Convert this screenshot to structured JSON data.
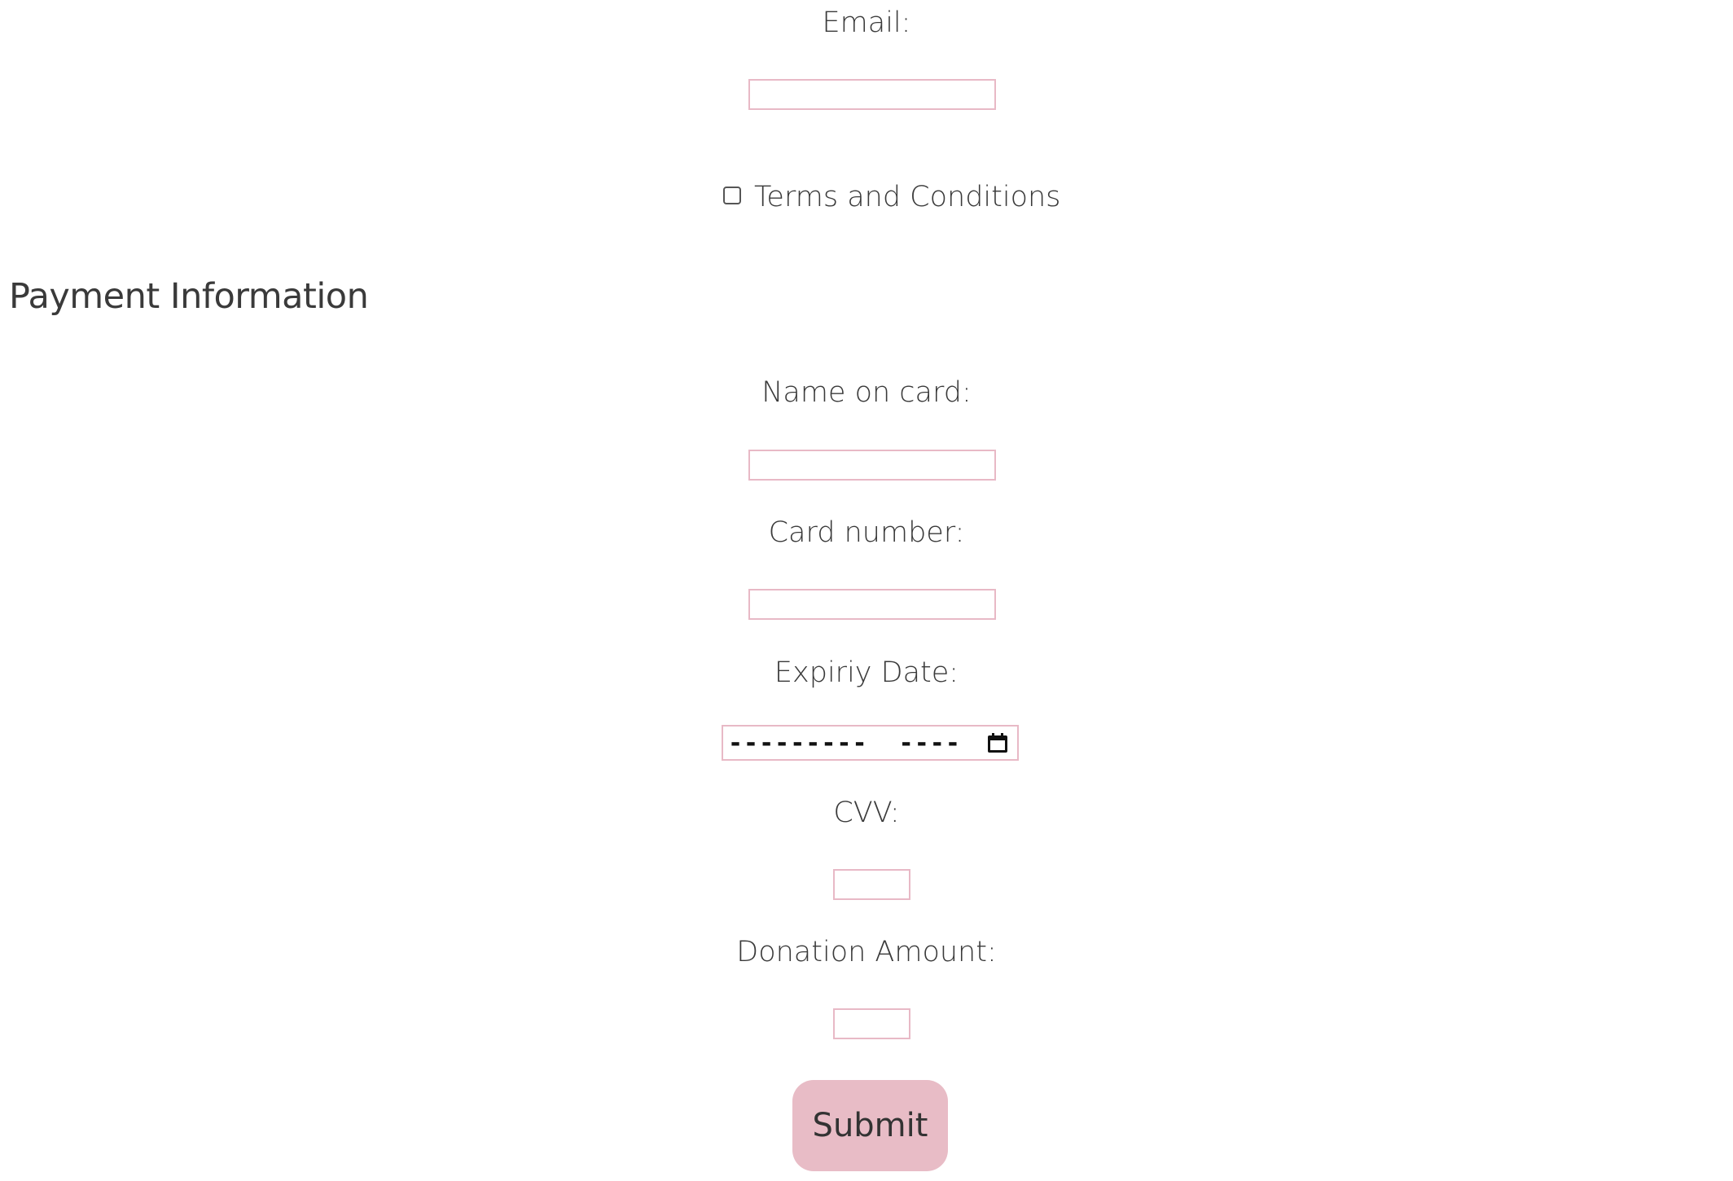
{
  "contact": {
    "email_label": "Email:",
    "email_value": "",
    "terms_label": "Terms and Conditions"
  },
  "payment": {
    "heading": "Payment Information",
    "name_label": "Name on card:",
    "name_value": "",
    "card_label": "Card number:",
    "card_value": "",
    "expiry_label": "Expiriy Date:",
    "expiry_display": "---------  ----",
    "cvv_label": "CVV:",
    "cvv_value": "",
    "donation_label": "Donation Amount:",
    "donation_value": ""
  },
  "actions": {
    "submit_label": "Submit"
  },
  "colors": {
    "field_border": "#e8b9c6",
    "submit_bg": "#e8bcc6",
    "text": "#3a3a3a"
  }
}
